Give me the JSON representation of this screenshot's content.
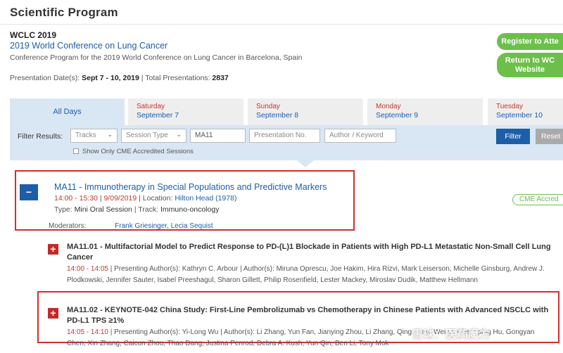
{
  "page": {
    "title": "Scientific Program"
  },
  "conference": {
    "short": "WCLC 2019",
    "long": "2019 World Conference on Lung Cancer",
    "description": "Conference Program for the 2019 World Conference on Lung Cancer in Barcelona, Spain",
    "dates_label": "Presentation Date(s):",
    "dates_value": "Sept 7 - 10, 2019",
    "total_label": "Total Presentations:",
    "total_value": "2837"
  },
  "actions": {
    "register": "Register to Atte",
    "return_line1": "Return to WC",
    "return_line2": "Website"
  },
  "tabs": [
    {
      "label": "All Days"
    },
    {
      "day": "Saturday",
      "date": "September 7"
    },
    {
      "day": "Sunday",
      "date": "September 8"
    },
    {
      "day": "Monday",
      "date": "September 9"
    },
    {
      "day": "Tuesday",
      "date": "September 10"
    }
  ],
  "filters": {
    "label": "Filter Results:",
    "tracks": "Tracks",
    "session_type": "Session Type",
    "session_value": "MA11",
    "presentation_placeholder": "Presentation No.",
    "author_placeholder": "Author / Keyword",
    "filter_button": "Filter",
    "reset_button": "Reset",
    "cme_only": "Show Only CME Accredited Sessions"
  },
  "session": {
    "title": "MA11 - Immunotherapy in Special Populations and Predictive Markers",
    "time": "14:00 - 15:30",
    "date": "9/09/2019",
    "location_label": "Location:",
    "location": "Hilton Head (1978)",
    "type_label": "Type:",
    "type": "Mini Oral Session",
    "track_label": "Track:",
    "track": "Immuno-oncology",
    "moderators_label": "Moderators:",
    "moderators": "Frank Griesinger, Lecia Sequist",
    "cme_badge": "CME Accred"
  },
  "presentations": [
    {
      "title": "MA11.01 - Multifactorial Model to Predict Response to PD-(L)1 Blockade in Patients with High PD-L1 Metastatic Non-Small Cell Lung Cancer",
      "time": "14:00 - 14:05",
      "meta": "  |  Presenting Author(s): Kathryn C. Arbour  |  Author(s): Miruna Oprescu, Joe Hakim, Hira Rizvi, Mark Leiserson, Michelle Ginsburg, Andrew J. Plodkowski, Jennifer Sauter, Isabel Preeshagul, Sharon Gillett, Philip Rosenfield, Lester Mackey, Miroslav Dudik, Matthew Hellmann"
    },
    {
      "title": "MA11.02 - KEYNOTE-042 China Study: First-Line Pembrolizumab vs Chemotherapy in Chinese Patients with Advanced NSCLC with PD-L1 TPS ≥1%",
      "time": "14:05 - 14:10",
      "meta": "  |  Presenting Author(s): Yi-Long Wu  |  Author(s): Li Zhang, Yun Fan, Jianying Zhou, Li Zhang, Qing Zhou, Wei Li, Chengping Hu, Gongyan Chen, Xin Zhang, Caicun Zhou, Thao Dang, Justina Penrod, Debra A. Kush, Yun Qin, Ben Li, Tony Mok"
    }
  ],
  "watermark": "雪球：医药魔方"
}
